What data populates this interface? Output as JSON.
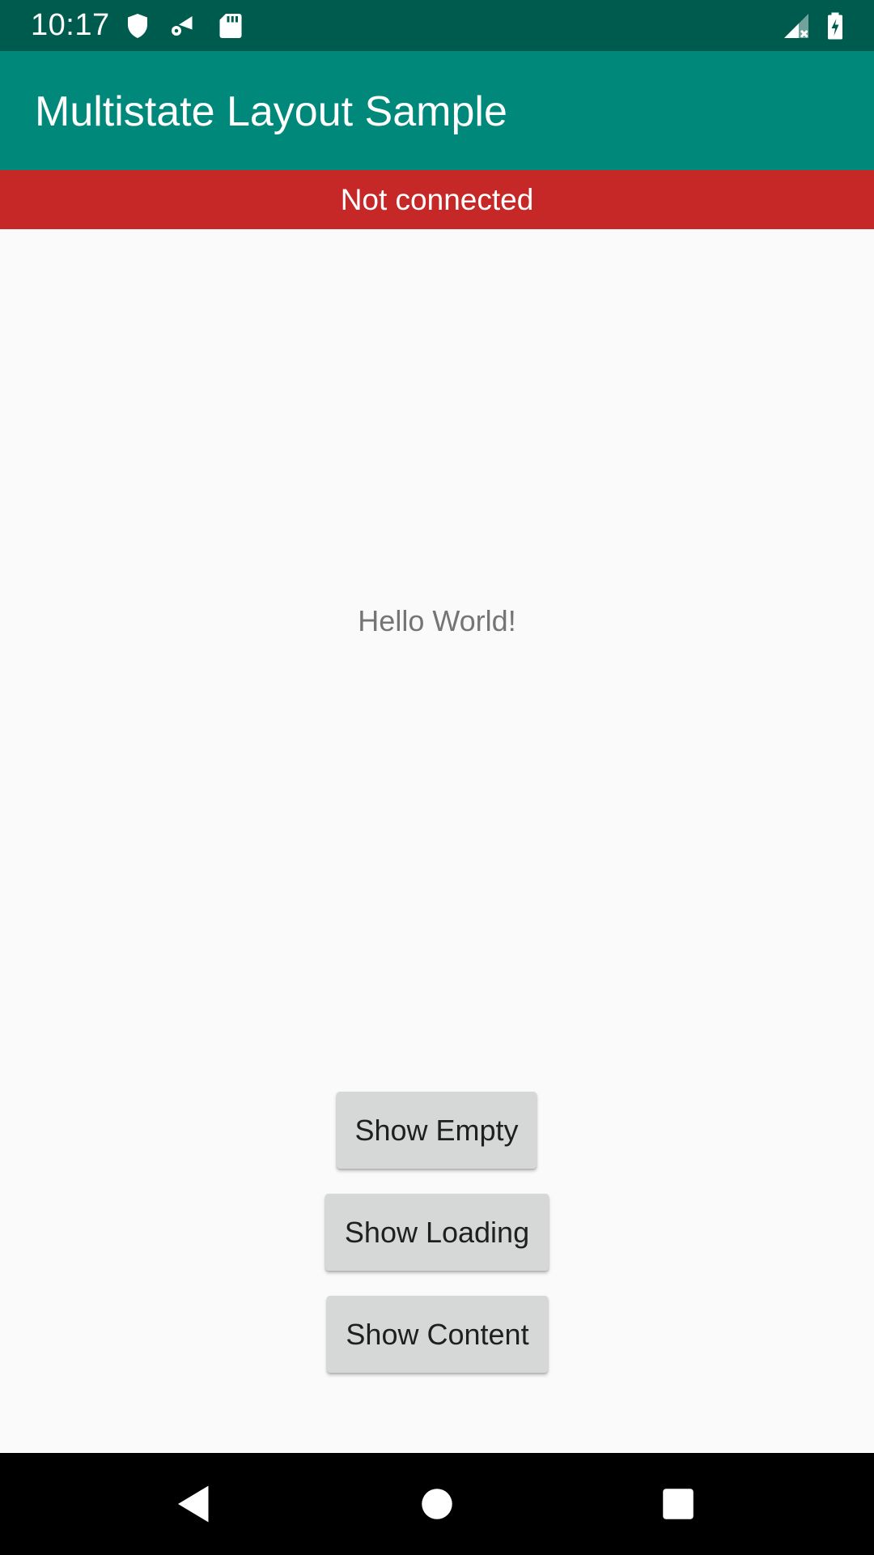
{
  "status_bar": {
    "time": "10:17",
    "left_icons": [
      "shield-icon",
      "wifi-settings-icon",
      "sd-card-icon"
    ],
    "right_icons": [
      "signal-no-data-icon",
      "battery-charging-icon"
    ]
  },
  "app_bar": {
    "title": "Multistate Layout Sample",
    "color": "#00897b"
  },
  "banner": {
    "text": "Not connected",
    "color": "#c62828"
  },
  "content": {
    "message": "Hello World!"
  },
  "buttons": {
    "show_empty": "Show Empty",
    "show_loading": "Show Loading",
    "show_content": "Show Content"
  },
  "nav_bar": {
    "icons": [
      "back-icon",
      "home-icon",
      "recents-icon"
    ]
  }
}
